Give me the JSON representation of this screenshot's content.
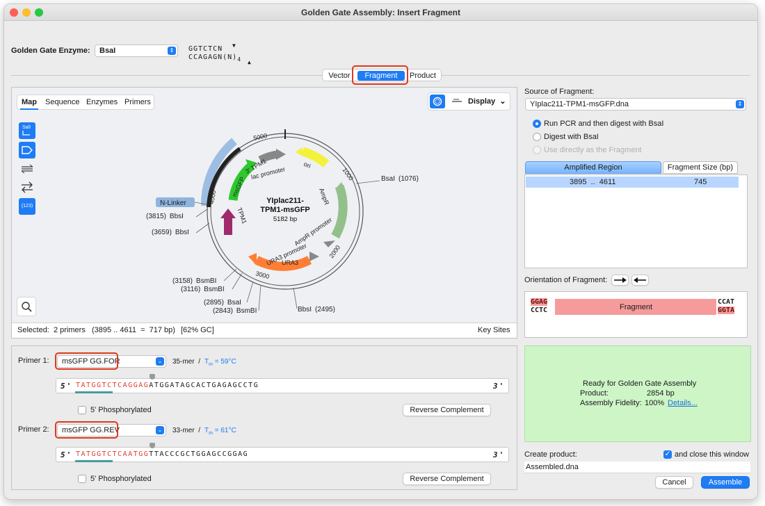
{
  "window": {
    "title": "Golden Gate Assembly: Insert Fragment"
  },
  "enzyme": {
    "label": "Golden Gate Enzyme:",
    "value": "BsaI",
    "site_top": "GGTCTCN",
    "site_bottom": "CCAGAGN(N)",
    "site_sub": "4"
  },
  "tabs": [
    {
      "label": "Vector"
    },
    {
      "label": "Fragment"
    },
    {
      "label": "Product"
    }
  ],
  "map": {
    "view_tabs": [
      "Map",
      "Sequence",
      "Enzymes",
      "Primers"
    ],
    "display_label": "Display",
    "plasmid_name_1": "YIplac211-",
    "plasmid_name_2": "TPM1-msGFP",
    "plasmid_size": "5182 bp",
    "tool_numbers": "(123)",
    "sites": [
      {
        "name": "BsaI",
        "pos": "(1076)"
      },
      {
        "name": "BbsI",
        "pos": "(3815)"
      },
      {
        "name": "BbsI",
        "pos": "(3659)"
      },
      {
        "name": "BsmBI",
        "pos": "(3158)"
      },
      {
        "name": "BsmBI",
        "pos": "(3116)"
      },
      {
        "name": "BsaI",
        "pos": "(2895)"
      },
      {
        "name": "BsmBI",
        "pos": "(2843)"
      },
      {
        "name": "BbsI",
        "pos": "(2495)"
      }
    ],
    "ticks": [
      "5000",
      "1000",
      "2000",
      "3000",
      "4000"
    ],
    "features": [
      "ori",
      "AmpR",
      "AmpR promoter",
      "URA3 promoter",
      "URA3",
      "TPM1",
      "msGFP",
      "3' TPM1",
      "lac promoter",
      "N-Linker"
    ],
    "status": {
      "selected": "Selected:  2 primers   (3895 .. 4611  =  717 bp)",
      "gc": "[62% GC]",
      "key_sites": "Key Sites"
    }
  },
  "source": {
    "label": "Source of Fragment:",
    "file": "YIplac211-TPM1-msGFP.dna",
    "options": [
      "Run PCR and then digest with BsaI",
      "Digest with BsaI",
      "Use directly as the Fragment"
    ],
    "region_header": "Amplified Region",
    "size_header": "Fragment Size (bp)",
    "region_value": "3895  ..  4611",
    "size_value": "745"
  },
  "orientation": {
    "label": "Orientation of Fragment:"
  },
  "fragment_preview": {
    "left_top": "GGAG",
    "left_bottom": "CCTC",
    "center": "Fragment",
    "right_top": "CCAT",
    "right_bottom": "GGTA"
  },
  "primers": [
    {
      "label": "Primer 1:",
      "name": "msGFP GG.FOR",
      "length": "35-mer  /",
      "tm_prefix": "T",
      "tm_sub": "m",
      "tm_value": " = 59°C",
      "five": "5'",
      "three": "3'",
      "seq_red": "TATGGTCTCAGGAG",
      "seq_black": "ATGGATAGCACTGAGAGCCTG",
      "phos": "5' Phosphorylated",
      "revcomp": "Reverse Complement"
    },
    {
      "label": "Primer 2:",
      "name": "msGFP GG.REV",
      "length": "33-mer  /",
      "tm_prefix": "T",
      "tm_sub": "m",
      "tm_value": " = 61°C",
      "five": "5'",
      "three": "3'",
      "seq_red": "TATGGTCTCAATGG",
      "seq_black": "TTACCCGCTGGAGCCGGAG",
      "phos": "5' Phosphorylated",
      "revcomp": "Reverse Complement"
    }
  ],
  "status_panel": {
    "ready": "Ready for Golden Gate Assembly",
    "product_label": "Product:",
    "product_value": "2854 bp",
    "fidelity_label": "Assembly Fidelity:",
    "fidelity_value": "100%",
    "details_link": "Details..."
  },
  "create": {
    "label": "Create product:",
    "close_label": "and close this window",
    "filename": "Assembled.dna",
    "cancel": "Cancel",
    "assemble": "Assemble"
  },
  "colors": {
    "accent": "#1e7cf5",
    "highlight_red": "#e0391e",
    "ready_bg": "#cdf5c6",
    "primer_red": "#e53b2c",
    "fragment_pink": "#f59b9b"
  }
}
